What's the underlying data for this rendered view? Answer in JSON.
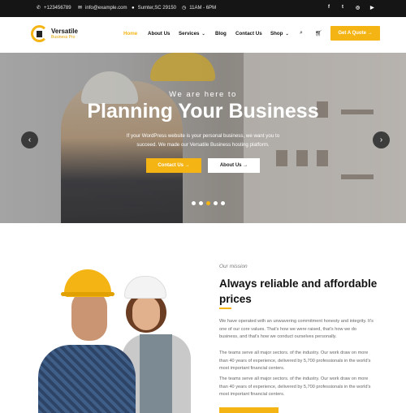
{
  "topbar": {
    "phone": "+123456789",
    "email": "info@example.com",
    "location": "Sumter,SC 29150",
    "hours": "11AM - 6PM",
    "social": [
      "f",
      "t",
      "◎",
      "▶"
    ]
  },
  "header": {
    "logo_name": "Versatile",
    "logo_tagline": "Business Pro",
    "nav": {
      "home": "Home",
      "about": "About Us",
      "services": "Services",
      "blog": "Blog",
      "contact": "Contact Us",
      "shop": "Shop"
    },
    "quote_button": "Get A Quote →"
  },
  "hero": {
    "subtitle": "We are here to",
    "title": "Planning Your Business",
    "description": "If your WordPress website is your personal business, we want you to succeed. We made our Versatile Business hosting platform.",
    "primary_button": "Contact Us →",
    "secondary_button": "About Us →",
    "prev_arrow": "‹",
    "next_arrow": "›",
    "slides": 5,
    "active_slide": 3
  },
  "mission": {
    "label": "Our mission",
    "title": "Always reliable and affordable prices",
    "paragraphs": [
      "We have operated with an unwavering commitment honesty and integrity. It's one of our core values. That's how we were raised, that's how we do business, and that's how we conduct ourselves personally.",
      "The teams serve all major sectors. of the industry. Our work draw on more than 40 years of experience, delivered by 5,700 professionals in the world's most important financial centers.",
      "The teams serve all major sectors. of the industry. Our work draw on more than 40 years of experience, delivered by 5,700 professionals in the world's most important financial centers."
    ]
  },
  "colors": {
    "accent": "#f4b414",
    "topbar_bg": "#151515"
  }
}
